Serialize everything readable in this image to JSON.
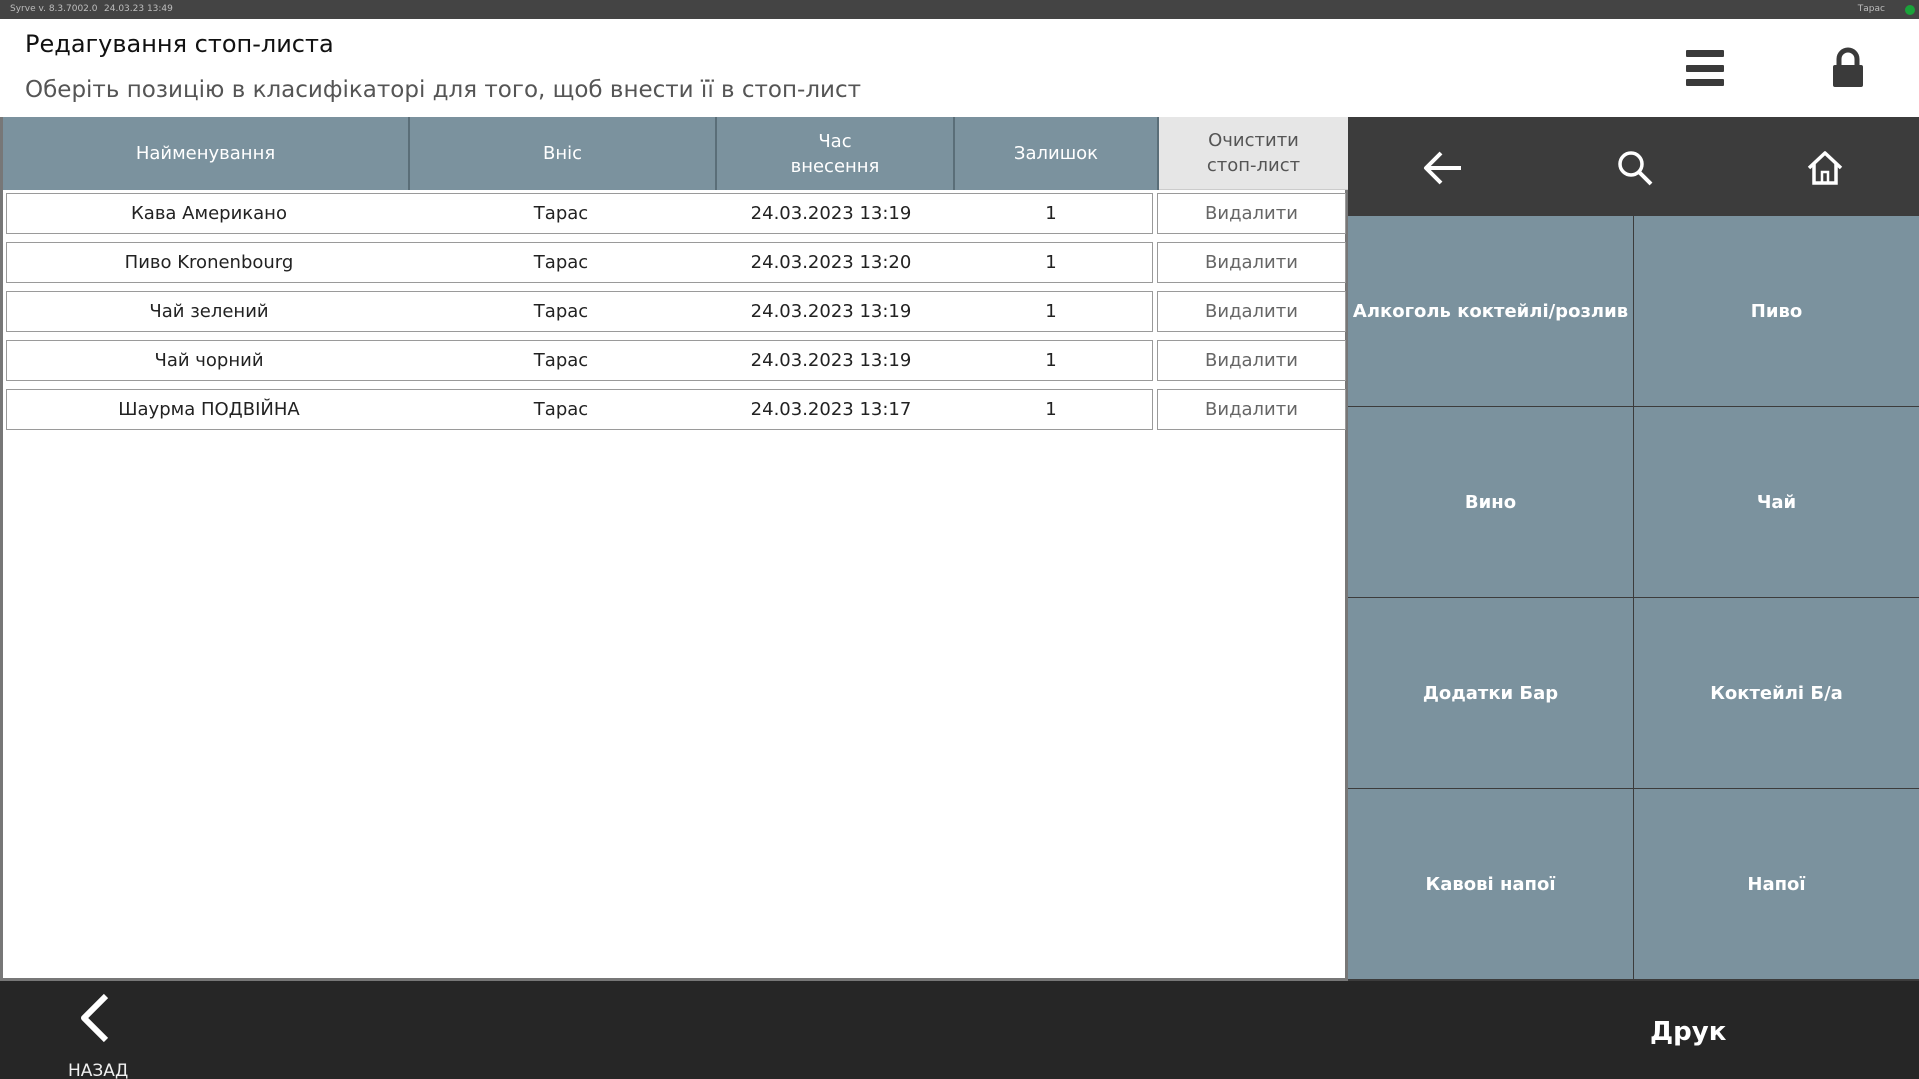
{
  "system_bar": {
    "version": "Syrve v. 8.3.7002.0",
    "datetime": "24.03.23   13:49",
    "user": "Тарас"
  },
  "header": {
    "title": "Редагування стоп-листа",
    "subtitle": "Оберіть позицію в класифікаторі для того, щоб внести її в стоп-лист"
  },
  "table": {
    "columns": [
      "Найменування",
      "Вніс",
      "Час\nвнесення",
      "Залишок"
    ],
    "clear_button": "Очистити стоп-лист",
    "delete_label": "Видалити",
    "rows": [
      {
        "name": "Кава Американо",
        "by": "Тарас",
        "time": "24.03.2023 13:19",
        "remain": "1"
      },
      {
        "name": "Пиво Kronenbourg",
        "by": "Тарас",
        "time": "24.03.2023 13:20",
        "remain": "1"
      },
      {
        "name": "Чай зелений",
        "by": "Тарас",
        "time": "24.03.2023 13:19",
        "remain": "1"
      },
      {
        "name": "Чай чорний",
        "by": "Тарас",
        "time": "24.03.2023 13:19",
        "remain": "1"
      },
      {
        "name": "Шаурма ПОДВІЙНА",
        "by": "Тарас",
        "time": "24.03.2023 13:17",
        "remain": "1"
      }
    ]
  },
  "categories": [
    "Алкоголь коктейлі/розлив",
    "Пиво",
    "Вино",
    "Чай",
    "Додатки Бар",
    "Коктейлі Б/а",
    "Кавові напої",
    "Напої"
  ],
  "footer": {
    "back_label": "НАЗАД",
    "print_label": "Друк"
  },
  "colors": {
    "accent": "#7b929e",
    "dark": "#3c3c3c",
    "footer": "#262626"
  }
}
